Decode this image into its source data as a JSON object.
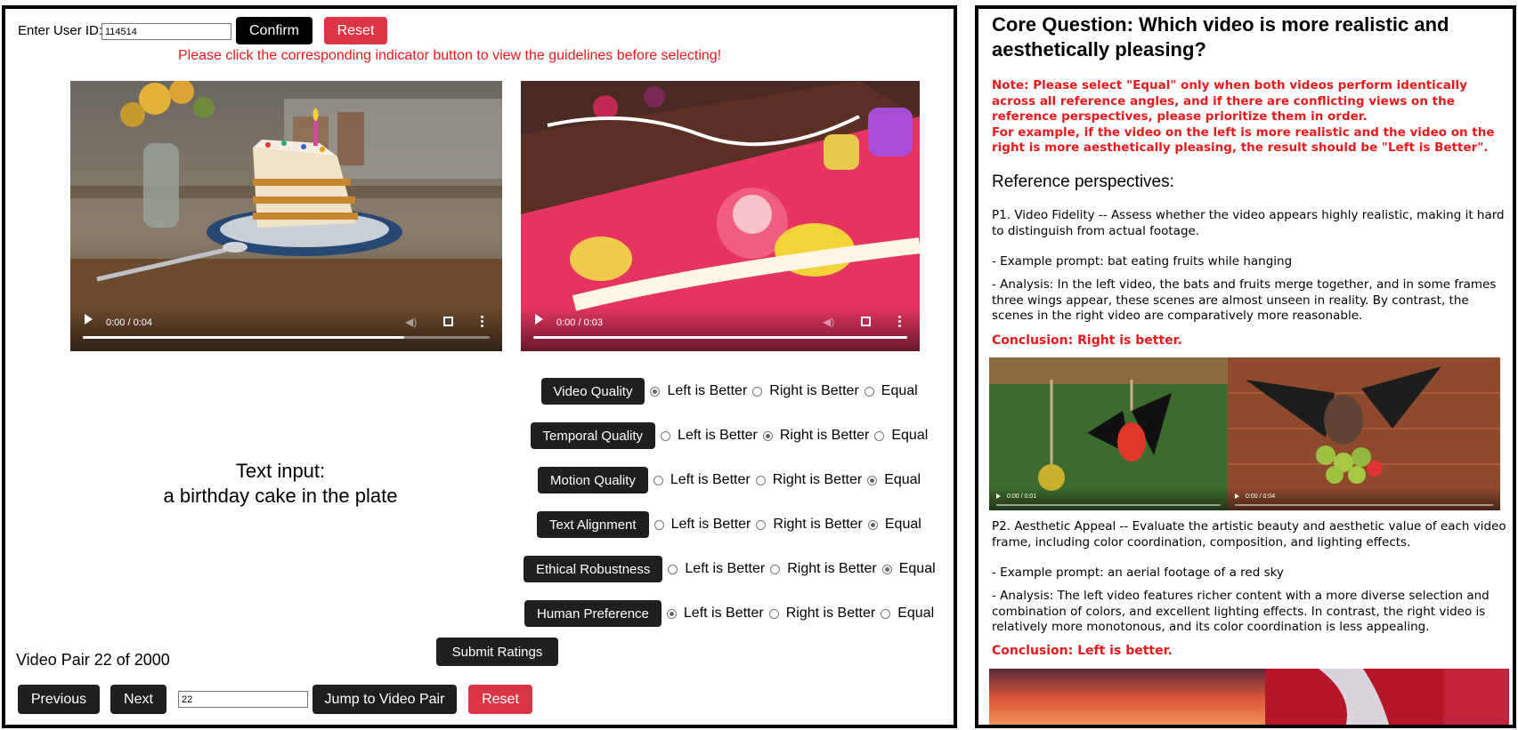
{
  "user": {
    "label": "Enter User ID:",
    "value": "114514",
    "confirm_label": "Confirm",
    "reset_label": "Reset"
  },
  "warning": "Please click the corresponding indicator button to view the guidelines before selecting!",
  "videos": {
    "left": {
      "time": "0:00 / 0:04",
      "progress": 0.79,
      "icon": "birthday-cake-scene"
    },
    "right": {
      "time": "0:00 / 0:03",
      "progress": 1.0,
      "icon": "colorful-cake-closeup"
    }
  },
  "prompt": {
    "label": "Text input:",
    "text": "a birthday cake in the plate"
  },
  "ratings": [
    {
      "criterion": "Video Quality",
      "selected": "left"
    },
    {
      "criterion": "Temporal Quality",
      "selected": "right"
    },
    {
      "criterion": "Motion Quality",
      "selected": "equal"
    },
    {
      "criterion": "Text Alignment",
      "selected": "equal"
    },
    {
      "criterion": "Ethical Robustness",
      "selected": "equal"
    },
    {
      "criterion": "Human Preference",
      "selected": "left"
    }
  ],
  "options": {
    "left": "Left is Better",
    "right": "Right is Better",
    "equal": "Equal"
  },
  "submit_label": "Submit Ratings",
  "pair_status": "Video Pair 22 of 2000",
  "nav": {
    "previous_label": "Previous",
    "next_label": "Next",
    "jump_value": "22",
    "jump_label": "Jump to Video Pair",
    "reset_label": "Reset"
  },
  "guide": {
    "title": "Core Question: Which video is more realistic and aesthetically pleasing?",
    "note": "Note: Please select \"Equal\" only when both videos perform identically across all reference angles, and if there are conflicting views on the reference perspectives, please prioritize them in order.",
    "note_example": "For example, if the video on the left is more realistic and the video on the right is more aesthetically pleasing, the result should be \"Left is Better\".",
    "heading": "Reference perspectives:",
    "p1": {
      "desc": "P1. Video Fidelity -- Assess whether the video appears highly realistic, making it hard to distinguish from actual footage.",
      "prompt": "- Example prompt: bat eating fruits while hanging",
      "analysis": "- Analysis: In the left video, the bats and fruits merge together, and in some frames three wings appear, these scenes are almost unseen in reality. By contrast, the scenes in the right video are comparatively more reasonable.",
      "conclusion": "Conclusion: Right is better.",
      "left_time": "0:00 / 0:01",
      "right_time": "0:00 / 0:04"
    },
    "p2": {
      "desc": "P2. Aesthetic Appeal -- Evaluate the artistic beauty and aesthetic value of each video frame, including color coordination, composition, and lighting effects.",
      "prompt": "- Example prompt: an aerial footage of a red sky",
      "analysis": "- Analysis: The left video features richer content with a more diverse selection and combination of colors, and excellent lighting effects. In contrast, the right video is relatively more monotonous, and its color coordination is less appealing.",
      "conclusion": "Conclusion: Left is better."
    }
  }
}
